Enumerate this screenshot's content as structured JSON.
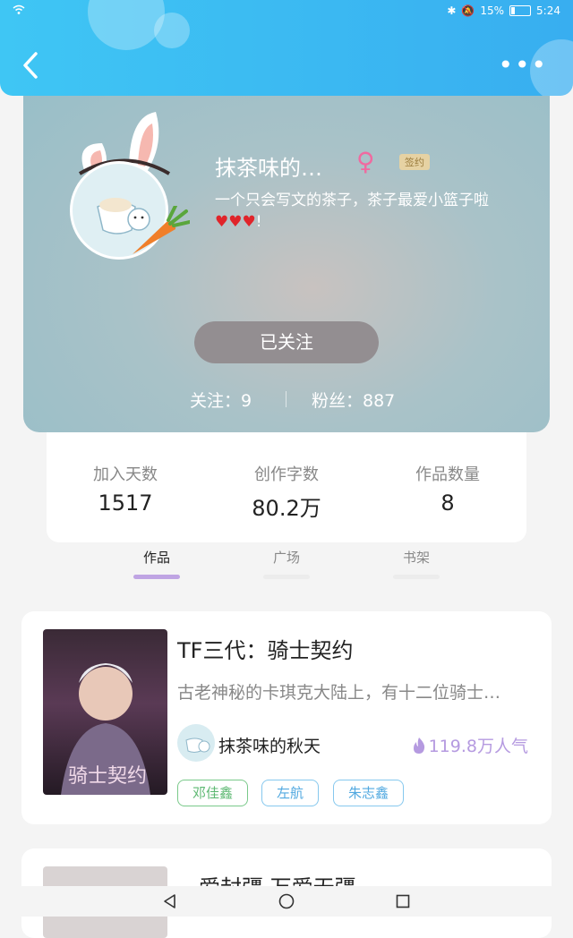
{
  "status_bar": {
    "battery": "15%",
    "time": "5:24"
  },
  "profile": {
    "name": "抹茶味的…",
    "badge": "签约",
    "bio": "一个只会写文的茶子，茶子最爱小篮子啦",
    "bio_end": "!",
    "follow_button": "已关注",
    "following_text": "关注：9",
    "fans_text": "粉丝：887"
  },
  "stats": [
    {
      "label": "加入天数",
      "value": "1517"
    },
    {
      "label": "创作字数",
      "value": "80.2万"
    },
    {
      "label": "作品数量",
      "value": "8"
    }
  ],
  "tabs": [
    {
      "label": "作品"
    },
    {
      "label": "广场"
    },
    {
      "label": "书架"
    }
  ],
  "works": [
    {
      "title": "TF三代：骑士契约",
      "cover_title": "骑士契约",
      "description": "古老神秘的卡琪克大陆上，有十二位骑士…",
      "author": "抹茶味的秋天",
      "popularity": "119.8万人气",
      "tags": [
        "邓佳鑫",
        "左航",
        "朱志鑫"
      ]
    },
    {
      "title": "一爱封疆 万爱无疆"
    }
  ],
  "colors": {
    "accent": "#38aef0",
    "tab_active": "#bfa4e3",
    "popularity": "#b59ae0"
  }
}
